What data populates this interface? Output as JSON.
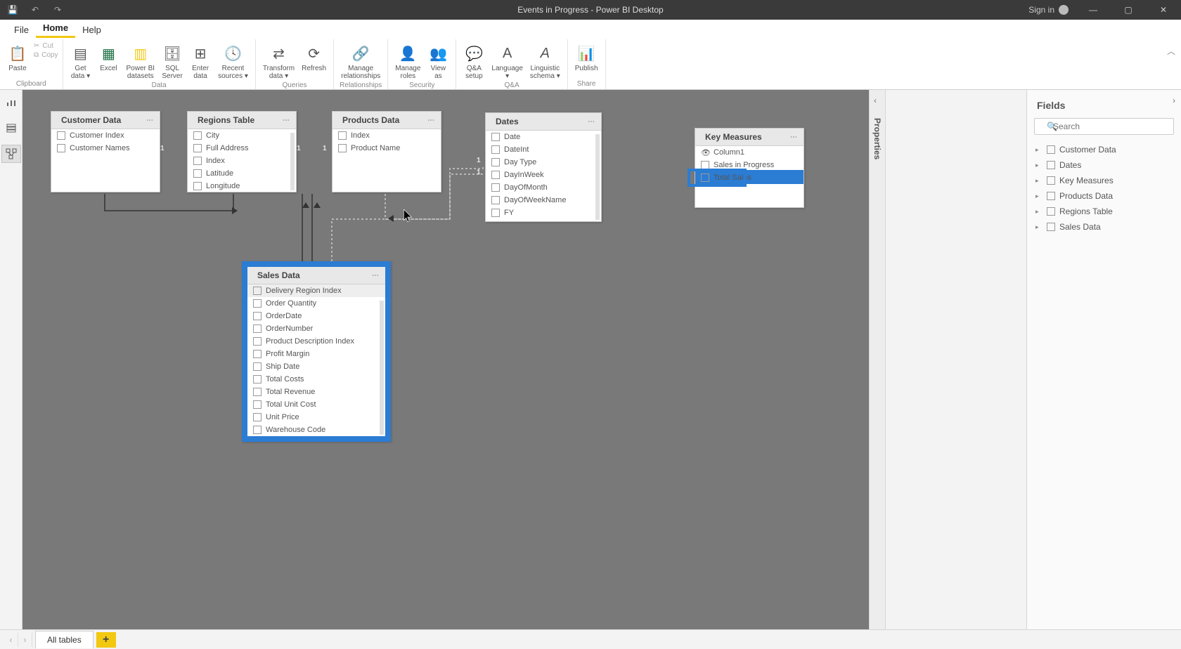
{
  "titlebar": {
    "title": "Events in Progress - Power BI Desktop",
    "signin": "Sign in"
  },
  "menu": {
    "file": "File",
    "home": "Home",
    "help": "Help"
  },
  "ribbon": {
    "clipboard": {
      "paste": "Paste",
      "cut": "Cut",
      "copy": "Copy",
      "group": "Clipboard"
    },
    "data": {
      "getdata": "Get\ndata ▾",
      "excel": "Excel",
      "pbidata": "Power BI\ndatasets",
      "sql": "SQL\nServer",
      "enter": "Enter\ndata",
      "recent": "Recent\nsources ▾",
      "group": "Data"
    },
    "queries": {
      "transform": "Transform\ndata ▾",
      "refresh": "Refresh",
      "group": "Queries"
    },
    "relationships": {
      "manage": "Manage\nrelationships",
      "group": "Relationships"
    },
    "security": {
      "roles": "Manage\nroles",
      "viewas": "View\nas",
      "group": "Security"
    },
    "qa": {
      "setup": "Q&A\nsetup",
      "lang": "Language\n▾",
      "ling": "Linguistic\nschema ▾",
      "group": "Q&A"
    },
    "share": {
      "publish": "Publish",
      "group": "Share"
    }
  },
  "canvas": {
    "customer": {
      "title": "Customer Data",
      "fields": [
        "Customer Index",
        "Customer Names"
      ]
    },
    "regions": {
      "title": "Regions Table",
      "fields": [
        "City",
        "Full Address",
        "Index",
        "Latitude",
        "Longitude"
      ]
    },
    "products": {
      "title": "Products Data",
      "fields": [
        "Index",
        "Product Name"
      ]
    },
    "dates": {
      "title": "Dates",
      "fields": [
        "Date",
        "DateInt",
        "Day Type",
        "DayInWeek",
        "DayOfMonth",
        "DayOfWeekName",
        "FY"
      ]
    },
    "keymeasures": {
      "title": "Key Measures",
      "fields": [
        "Column1",
        "Sales in Progress",
        "Total Sales"
      ]
    },
    "sales": {
      "title": "Sales Data",
      "fields": [
        "Delivery Region Index",
        "Order Quantity",
        "OrderDate",
        "OrderNumber",
        "Product Description Index",
        "Profit Margin",
        "Ship Date",
        "Total Costs",
        "Total Revenue",
        "Total Unit Cost",
        "Unit Price",
        "Warehouse Code"
      ]
    }
  },
  "rail": {
    "properties": "Properties"
  },
  "fieldspane": {
    "title": "Fields",
    "search_placeholder": "Search",
    "tables": [
      "Customer Data",
      "Dates",
      "Key Measures",
      "Products Data",
      "Regions Table",
      "Sales Data"
    ]
  },
  "bottom": {
    "tab": "All tables"
  }
}
